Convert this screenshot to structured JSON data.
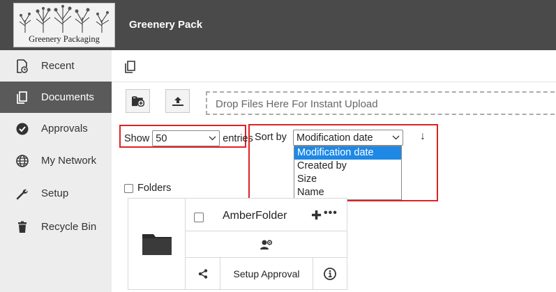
{
  "brand": {
    "logo_text": "Greenery Packaging",
    "header_color": "#4a4a4a",
    "accent": "#1e88e5",
    "highlight": "#dd2222"
  },
  "header": {
    "title": "Greenery Pack"
  },
  "sidebar": {
    "items": [
      {
        "label": "Recent",
        "icon": "recent-file-icon",
        "active": false
      },
      {
        "label": "Documents",
        "icon": "documents-icon",
        "active": true
      },
      {
        "label": "Approvals",
        "icon": "check-circle-icon",
        "active": false
      },
      {
        "label": "My Network",
        "icon": "globe-icon",
        "active": false
      },
      {
        "label": "Setup",
        "icon": "wrench-icon",
        "active": false
      },
      {
        "label": "Recycle Bin",
        "icon": "trash-icon",
        "active": false
      }
    ]
  },
  "toolbar": {
    "drop_text": "Drop Files Here For Instant Upload"
  },
  "listing": {
    "show_label": "Show",
    "entries_value": "50",
    "entries_label": "entries",
    "sort_label": "Sort by",
    "sort_value": "Modification date",
    "sort_direction": "↓",
    "sort_options": [
      "Modification date",
      "Created by",
      "Size",
      "Name"
    ],
    "sort_selected_index": 0
  },
  "folders": {
    "label": "Folders",
    "items": [
      {
        "name": "AmberFolder",
        "approval_label": "Setup Approval"
      }
    ]
  }
}
